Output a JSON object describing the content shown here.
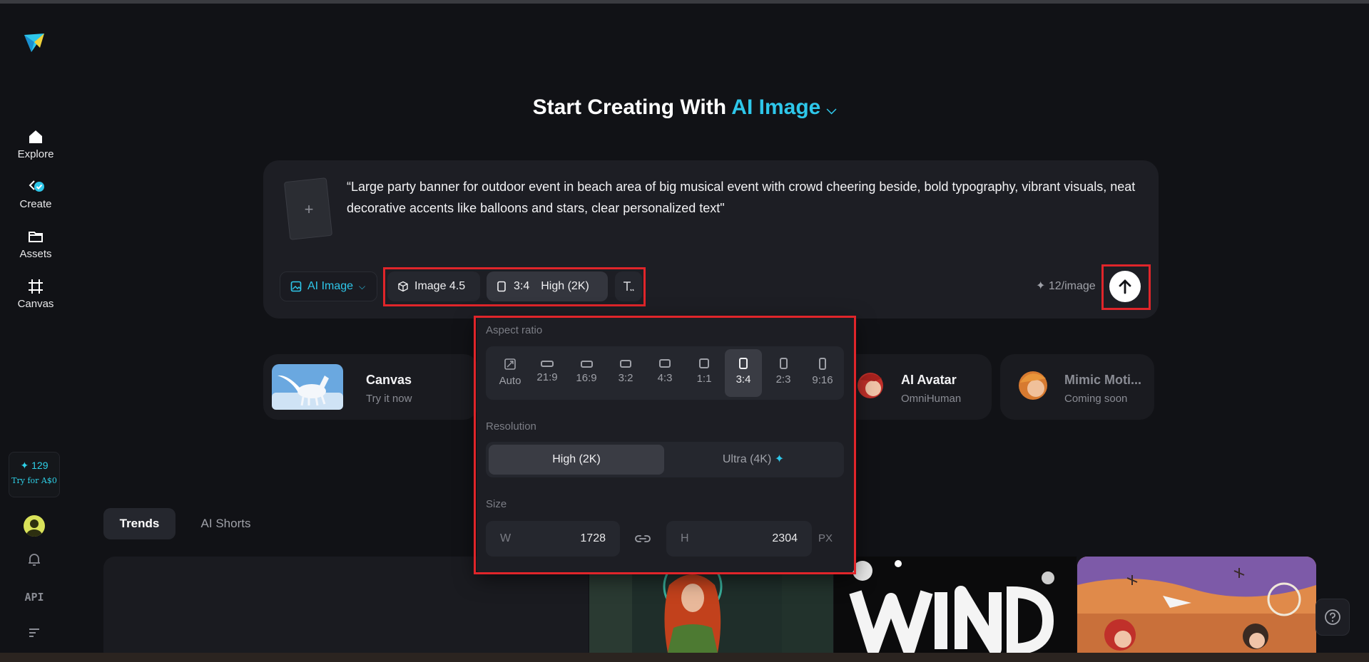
{
  "sidebar": {
    "items": [
      {
        "label": "Explore",
        "icon": "home-icon"
      },
      {
        "label": "Create",
        "icon": "create-icon"
      },
      {
        "label": "Assets",
        "icon": "folder-icon"
      },
      {
        "label": "Canvas",
        "icon": "canvas-icon"
      }
    ],
    "credits": "✦ 129",
    "try_label": "Try for A$0",
    "api_label": "API"
  },
  "headline": {
    "prefix": "Start Creating With",
    "accent": "AI Image"
  },
  "prompt": {
    "text": "“Large party banner for  outdoor event in beach area of big musical event with crowd cheering beside, bold typography, vibrant visuals, neat decorative accents like balloons and stars, clear personalized text\"",
    "add_label": "+"
  },
  "toolbar": {
    "mode_label": "AI Image",
    "model_label": "Image 4.5",
    "ratio_label": "3:4",
    "quality_label": "High (2K)",
    "cost_label": "✦ 12/image"
  },
  "features": [
    {
      "title": "Canvas",
      "sub": "Try it now"
    },
    {
      "title": "AI Avatar",
      "sub": "OmniHuman"
    },
    {
      "title": "Mimic Moti...",
      "sub": "Coming soon"
    }
  ],
  "dropdown": {
    "aspect_label": "Aspect ratio",
    "ratios": [
      "Auto",
      "21:9",
      "16:9",
      "3:2",
      "4:3",
      "1:1",
      "3:4",
      "2:3",
      "9:16"
    ],
    "selected_ratio": "3:4",
    "resolution_label": "Resolution",
    "res_high": "High (2K)",
    "res_ultra": "Ultra (4K)",
    "size_label": "Size",
    "w_key": "W",
    "w_val": "1728",
    "h_key": "H",
    "h_val": "2304",
    "unit": "PX"
  },
  "tabs": [
    "Trends",
    "AI Shorts"
  ],
  "colors": {
    "accent": "#2ec7ea",
    "highlight": "#e0252a",
    "background": "#111216"
  }
}
